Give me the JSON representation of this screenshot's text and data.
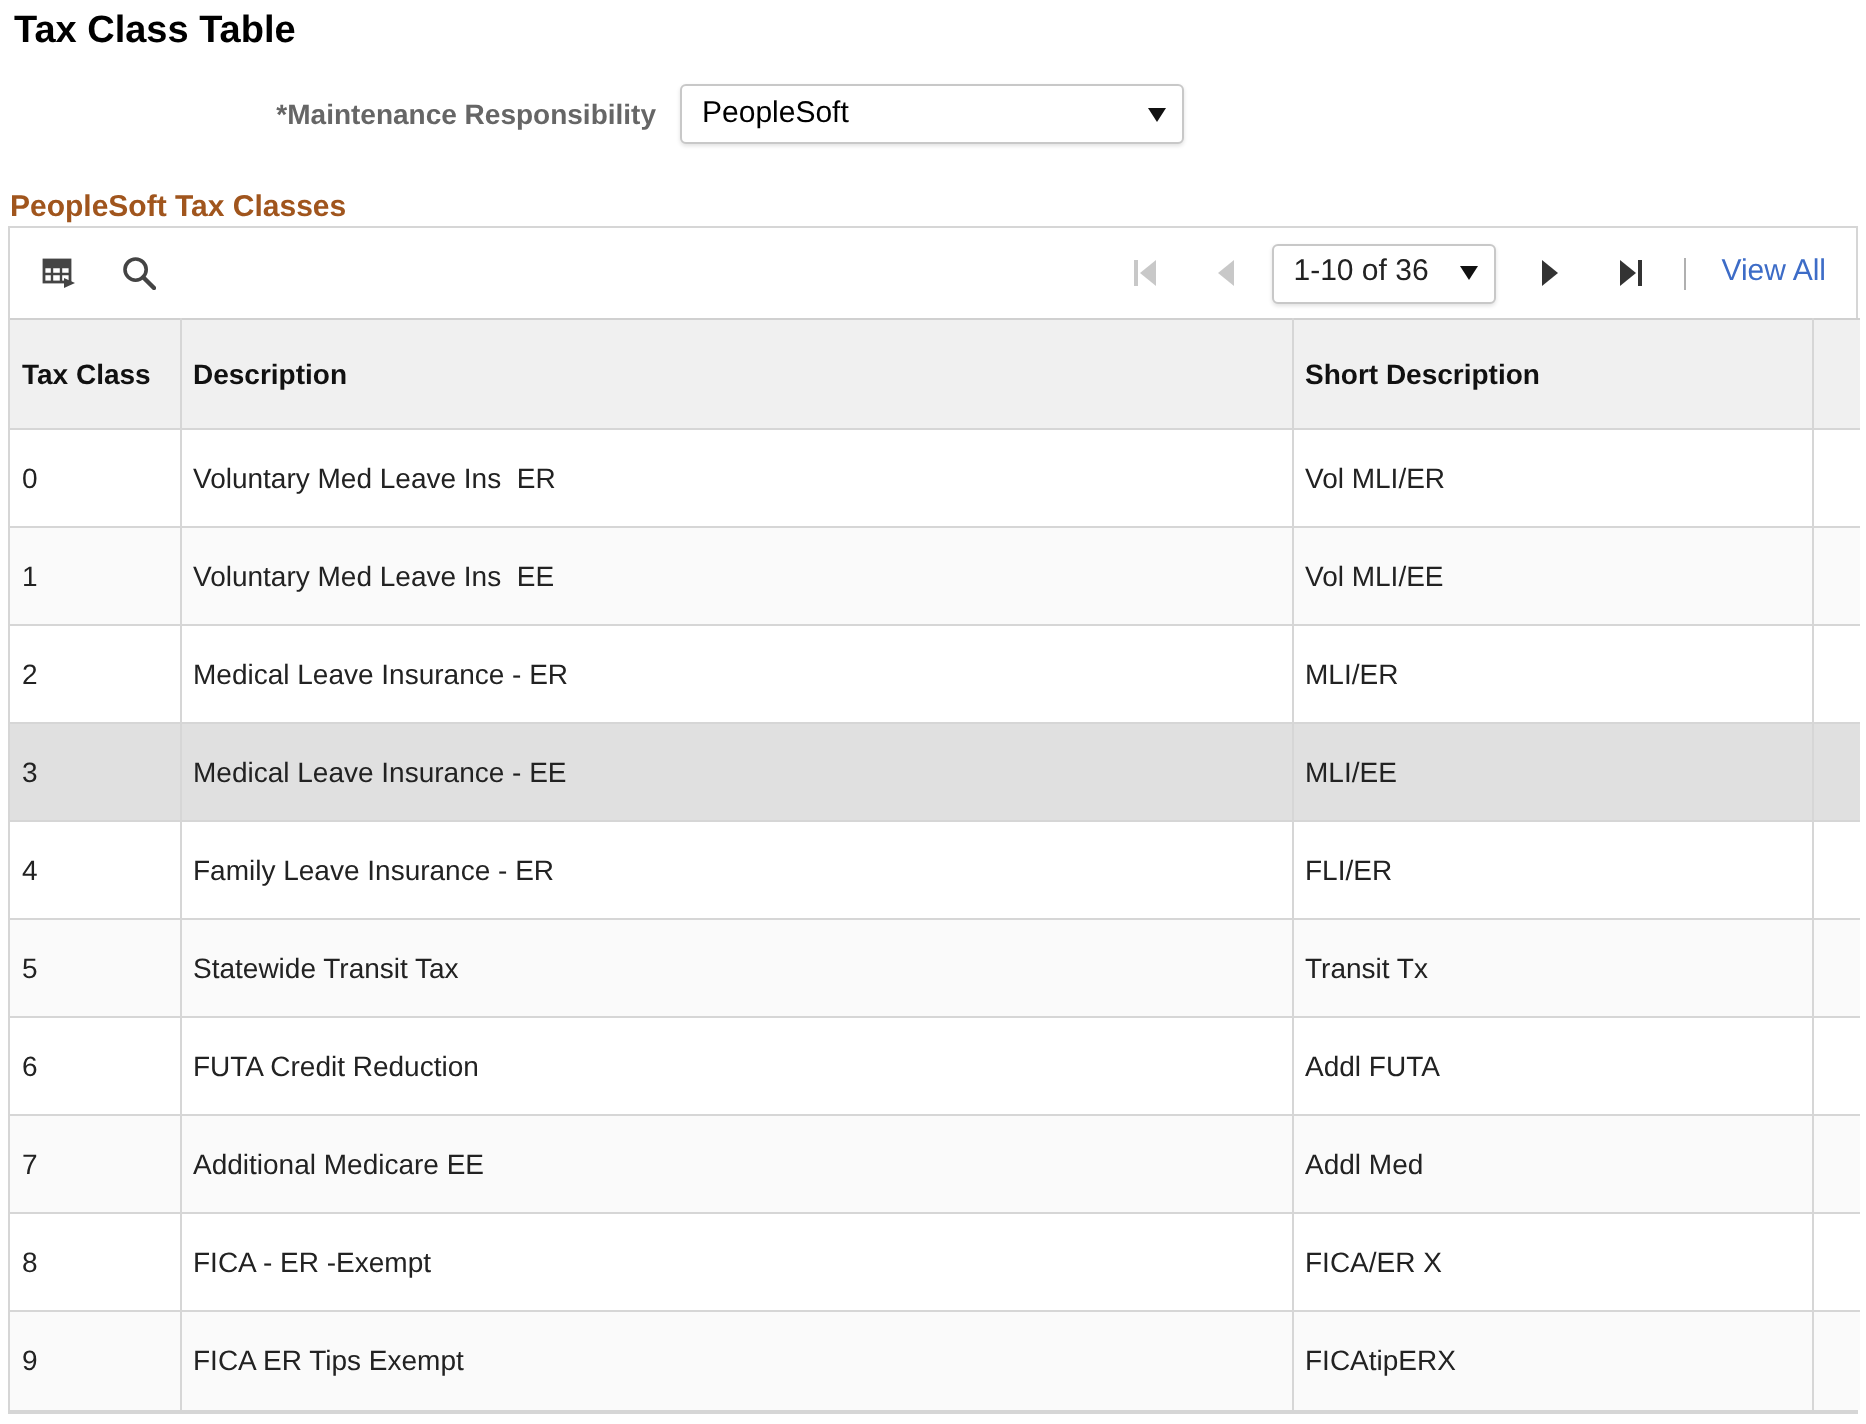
{
  "page": {
    "title": "Tax Class Table"
  },
  "maintenance": {
    "label": "*Maintenance Responsibility",
    "value": "PeopleSoft"
  },
  "grid": {
    "title": "PeopleSoft Tax Classes",
    "pager": {
      "first": {
        "disabled": true
      },
      "previous": {
        "disabled": true
      },
      "range": "1-10 of 36",
      "next": {
        "disabled": false
      },
      "last": {
        "disabled": false
      },
      "view_all": "View All"
    },
    "columns": [
      "Tax Class",
      "Description",
      "Short Description"
    ],
    "rows": [
      {
        "tax_class": "0",
        "description": "Voluntary Med Leave Ins  ER",
        "short_description": "Vol MLI/ER",
        "selected": false
      },
      {
        "tax_class": "1",
        "description": "Voluntary Med Leave Ins  EE",
        "short_description": "Vol MLI/EE",
        "selected": false
      },
      {
        "tax_class": "2",
        "description": "Medical Leave Insurance - ER",
        "short_description": "MLI/ER",
        "selected": false
      },
      {
        "tax_class": "3",
        "description": "Medical Leave Insurance - EE",
        "short_description": "MLI/EE",
        "selected": true
      },
      {
        "tax_class": "4",
        "description": "Family Leave Insurance - ER",
        "short_description": "FLI/ER",
        "selected": false
      },
      {
        "tax_class": "5",
        "description": "Statewide Transit Tax",
        "short_description": "Transit Tx",
        "selected": false
      },
      {
        "tax_class": "6",
        "description": "FUTA Credit Reduction",
        "short_description": "Addl FUTA",
        "selected": false
      },
      {
        "tax_class": "7",
        "description": "Additional Medicare EE",
        "short_description": "Addl Med",
        "selected": false
      },
      {
        "tax_class": "8",
        "description": "FICA - ER -Exempt",
        "short_description": "FICA/ER X",
        "selected": false
      },
      {
        "tax_class": "9",
        "description": "FICA ER Tips Exempt",
        "short_description": "FICAtipERX",
        "selected": false
      }
    ]
  }
}
